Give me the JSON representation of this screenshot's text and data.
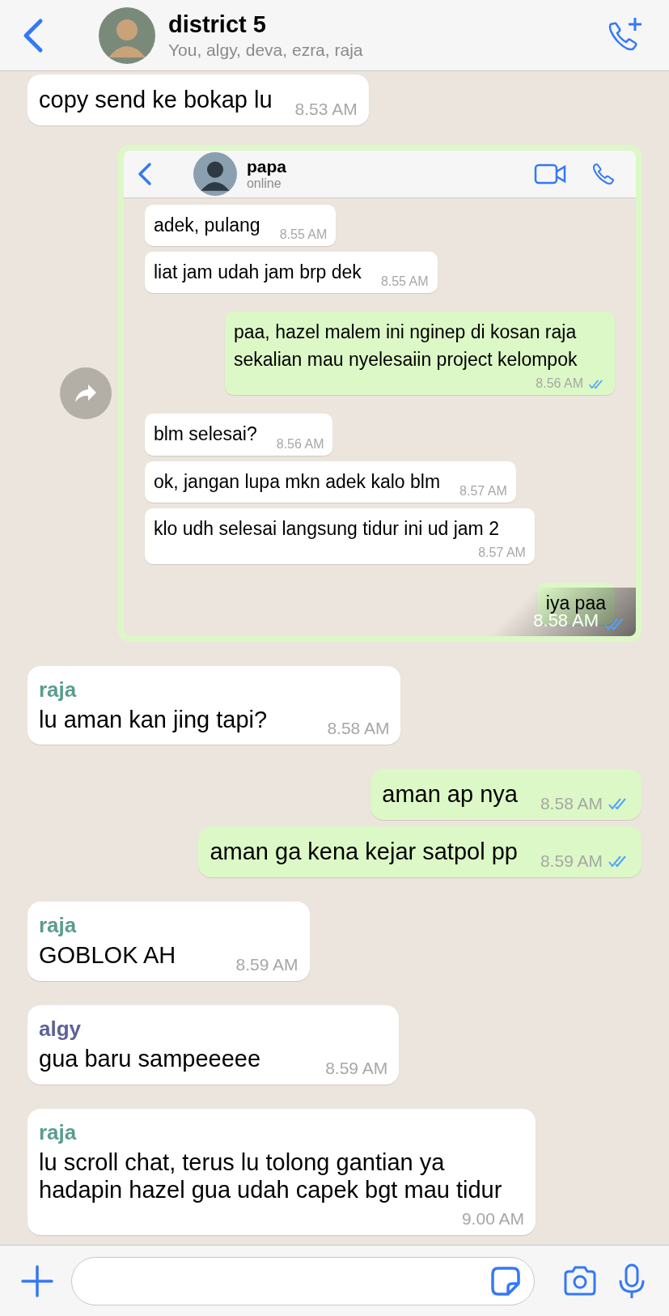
{
  "header": {
    "title": "district 5",
    "subtitle": "You, algy, deva, ezra, raja"
  },
  "messages": [
    {
      "kind": "text",
      "outgoing": false,
      "text": "copy send ke bokap lu",
      "time": "8.53 AM"
    },
    {
      "kind": "screenshot",
      "outgoing": true,
      "time": "8.58 AM",
      "read": true,
      "header": {
        "title": "papa",
        "subtitle": "online"
      },
      "messages": [
        {
          "outgoing": false,
          "text": "adek, pulang",
          "time": "8.55 AM"
        },
        {
          "outgoing": false,
          "text": "liat jam udah jam brp dek",
          "time": "8.55 AM"
        },
        {
          "outgoing": true,
          "text": "paa, hazel malem ini nginep di kosan raja sekalian mau nyelesaiin project kelompok",
          "time": "8.56 AM",
          "read": true
        },
        {
          "outgoing": false,
          "text": "blm selesai?",
          "time": "8.56 AM"
        },
        {
          "outgoing": false,
          "text": "ok, jangan lupa mkn adek kalo blm",
          "time": "8.57 AM"
        },
        {
          "outgoing": false,
          "text": "klo udh selesai langsung tidur ini ud jam 2",
          "time": "8.57 AM"
        },
        {
          "outgoing": true,
          "text": "iya paa"
        }
      ]
    },
    {
      "kind": "text",
      "outgoing": false,
      "sender": "raja",
      "color": "#5a9c90",
      "text": "lu aman kan jing tapi?",
      "time": "8.58 AM"
    },
    {
      "kind": "text",
      "outgoing": true,
      "text": "aman ap nya",
      "time": "8.58 AM",
      "read": true
    },
    {
      "kind": "text",
      "outgoing": true,
      "text": "aman ga kena kejar satpol pp",
      "time": "8.59 AM",
      "read": true
    },
    {
      "kind": "text",
      "outgoing": false,
      "sender": "raja",
      "color": "#5a9c90",
      "text": "GOBLOK AH",
      "time": "8.59 AM"
    },
    {
      "kind": "text",
      "outgoing": false,
      "sender": "algy",
      "color": "#5c6296",
      "text": "gua baru sampeeeee",
      "time": "8.59 AM"
    },
    {
      "kind": "text",
      "outgoing": false,
      "sender": "raja",
      "color": "#5a9c90",
      "text": "lu scroll chat, terus lu tolong gantian ya hadapin hazel gua udah capek bgt mau tidur",
      "time": "9.00 AM"
    }
  ]
}
